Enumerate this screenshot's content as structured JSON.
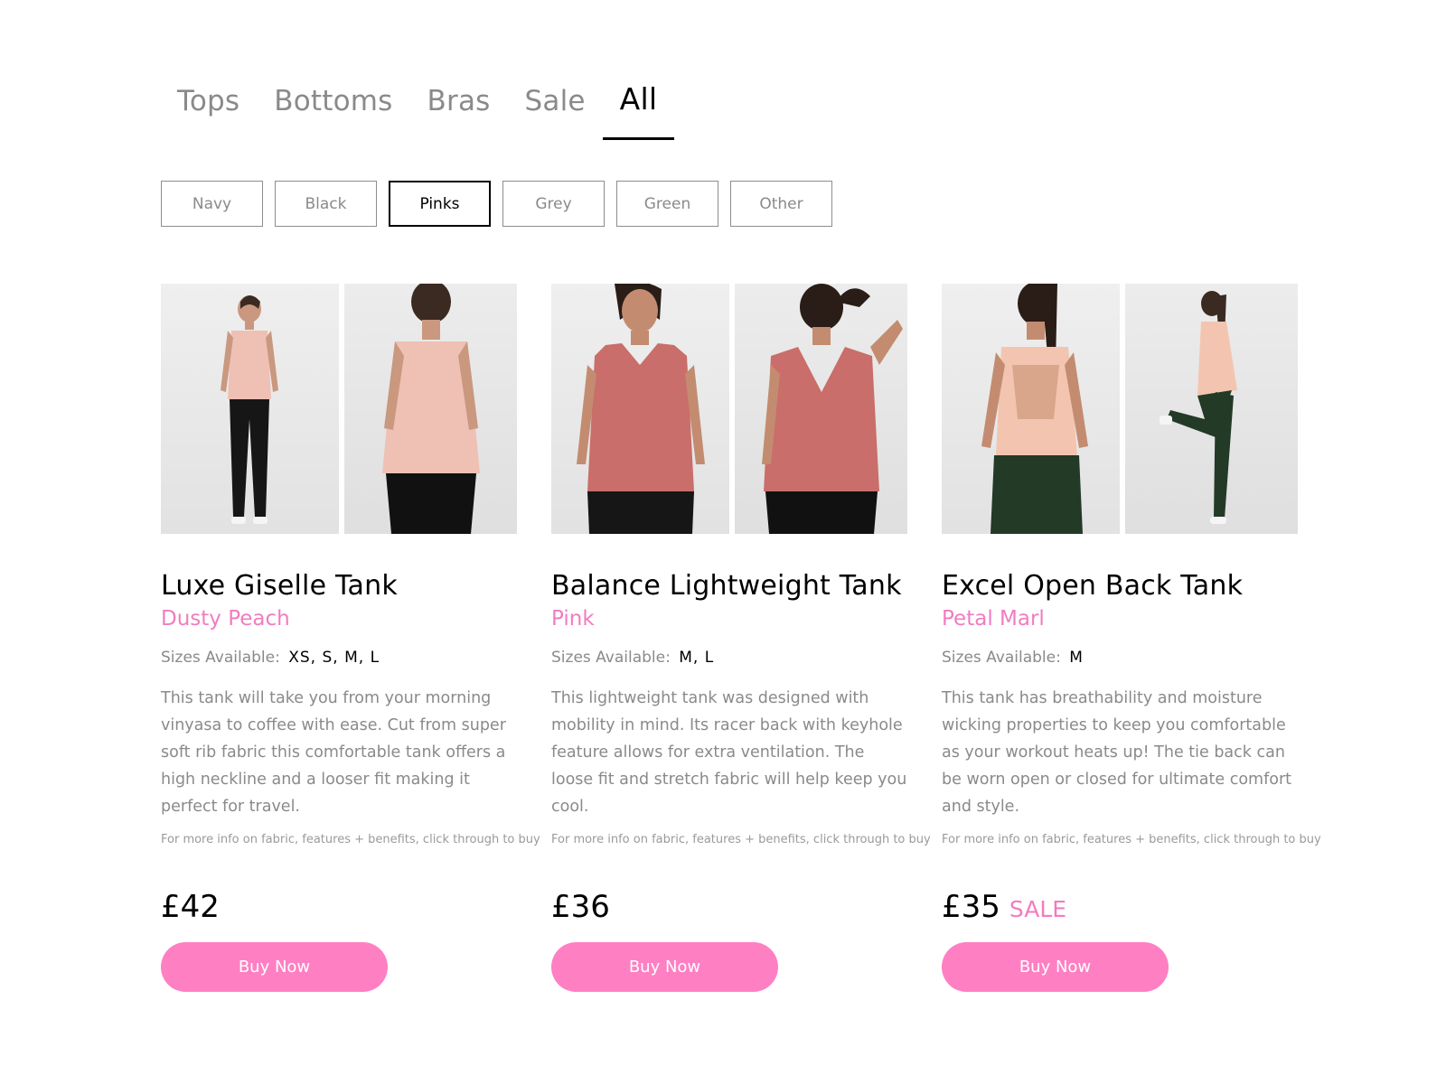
{
  "tabs": [
    {
      "label": "Tops"
    },
    {
      "label": "Bottoms"
    },
    {
      "label": "Bras"
    },
    {
      "label": "Sale"
    },
    {
      "label": "All",
      "active": true
    }
  ],
  "filters": [
    {
      "label": "Navy"
    },
    {
      "label": "Black"
    },
    {
      "label": "Pinks",
      "active": true
    },
    {
      "label": "Grey"
    },
    {
      "label": "Green"
    },
    {
      "label": "Other"
    }
  ],
  "sizes_label": "Sizes Available:",
  "info_text": "For more info on fabric, features + benefits, click through to buy",
  "buy_label": "Buy Now",
  "colors": {
    "accent": "#ff7fc3",
    "color_text": "#f27cc0",
    "muted": "#8a8a8a"
  },
  "products": [
    {
      "name": "Luxe Giselle Tank",
      "color": "Dusty Peach",
      "sizes": "XS, S, M, L",
      "description": "This tank will take you from your morning vinyasa to coffee with ease. Cut from super soft rib fabric this comfortable tank offers a high neckline and a looser fit making it perfect for travel.",
      "price": "£42",
      "sale": "",
      "images": [
        "model-front-photo",
        "model-back-photo"
      ]
    },
    {
      "name": "Balance Lightweight Tank",
      "color": "Pink",
      "sizes": "M, L",
      "description": "This lightweight tank was designed with mobility in mind. Its racer back with keyhole feature allows for extra ventilation. The loose fit and stretch fabric will help keep you cool.",
      "price": "£36",
      "sale": "",
      "images": [
        "model-front-photo",
        "model-back-photo"
      ]
    },
    {
      "name": "Excel Open Back Tank",
      "color": "Petal Marl",
      "sizes": "M",
      "description": "This tank has breathability and moisture wicking properties to keep you comfortable as your workout heats up! The tie back can be worn open or closed for ultimate comfort and style.",
      "price": "£35",
      "sale": "SALE",
      "images": [
        "model-back-photo",
        "model-side-photo"
      ]
    }
  ]
}
